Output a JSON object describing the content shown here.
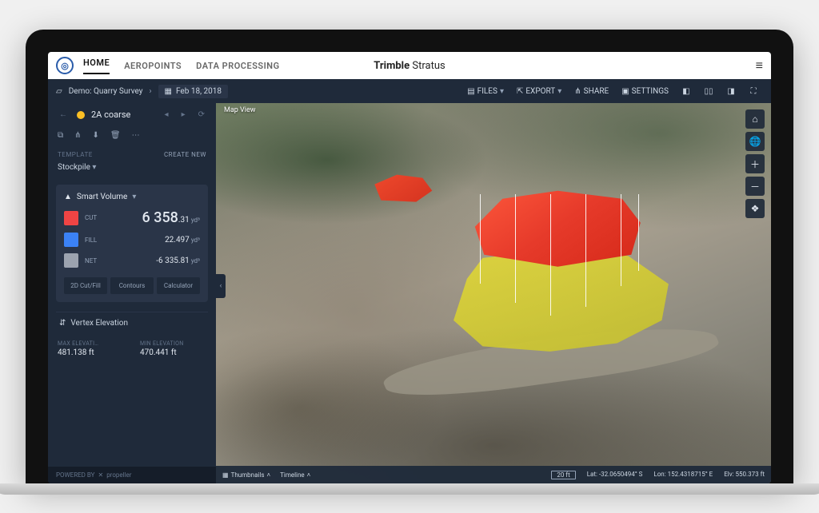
{
  "brand": {
    "bold": "Trimble",
    "light": "Stratus"
  },
  "nav": {
    "home": "HOME",
    "aeropoints": "AEROPOINTS",
    "data_processing": "DATA PROCESSING"
  },
  "subbar": {
    "project": "Demo: Quarry Survey",
    "date": "Feb 18, 2018",
    "files": "FILES",
    "export": "EXPORT",
    "share": "SHARE",
    "settings": "SETTINGS"
  },
  "sidebar": {
    "item_name": "2A coarse",
    "template_label": "TEMPLATE",
    "create_new": "CREATE NEW",
    "template_value": "Stockpile",
    "card_title": "Smart Volume",
    "cut": {
      "label": "CUT",
      "big": "6 358",
      "dec": ".31",
      "unit": "yd³"
    },
    "fill": {
      "label": "FILL",
      "val": "22.497",
      "unit": "yd³"
    },
    "net": {
      "label": "NET",
      "val": "-6 335.81",
      "unit": "yd³"
    },
    "btn_2d": "2D Cut/Fill",
    "btn_contours": "Contours",
    "btn_calc": "Calculator",
    "vertex_title": "Vertex Elevation",
    "max_elev_label": "MAX ELEVATI…",
    "max_elev_val": "481.138 ft",
    "min_elev_label": "MIN ELEVATION",
    "min_elev_val": "470.441 ft",
    "powered_by": "POWERED BY",
    "powered_brand": "propeller"
  },
  "viewport": {
    "map_view": "Map View",
    "thumbnails": "Thumbnails",
    "timeline": "Timeline",
    "scale": "20 ft",
    "lat_label": "Lat:",
    "lat_val": "-32.0650494° S",
    "lon_label": "Lon:",
    "lon_val": "152.4318715° E",
    "elv_label": "Elv:",
    "elv_val": "550.373 ft"
  }
}
